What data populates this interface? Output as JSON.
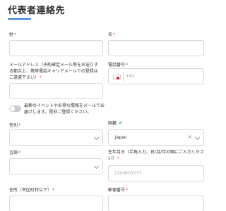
{
  "section": {
    "title": "代表者連絡先"
  },
  "fields": {
    "last_name": {
      "label": "姓",
      "value": ""
    },
    "first_name": {
      "label": "名",
      "value": ""
    },
    "email": {
      "label": "メールアドレス（予約確定メール等をお送りする都合上、携帯電話キャリアメールでの登録はご遠慮下さい）",
      "value": ""
    },
    "phone": {
      "label": "電話番号",
      "dial_code": "+81",
      "value": ""
    },
    "newsletter": {
      "label": "最新のイベントやお得な情報をメールでお届けします。是非ご登録ください。",
      "enabled": false
    },
    "gender": {
      "label": "性別",
      "value": ""
    },
    "nationality": {
      "label": "国籍",
      "value": "Japan"
    },
    "language": {
      "label": "言語",
      "value": ""
    },
    "birthdate": {
      "label": "生年月日（半角入力、日/月/年の順にご入力ください）",
      "placeholder": "DD/MM/YYYY"
    },
    "address": {
      "label": "住所（市区町村以下）",
      "value": ""
    },
    "postal_code": {
      "label": "郵便番号",
      "value": ""
    }
  },
  "required_mark": "*",
  "icons": {
    "flag": "japan-flag-icon",
    "check": "check-icon",
    "clear": "close-icon",
    "dropdown": "chevron-down-icon"
  },
  "colors": {
    "accent": "#3a7bd5",
    "required": "#e0342f",
    "check": "#2eaa4a"
  }
}
